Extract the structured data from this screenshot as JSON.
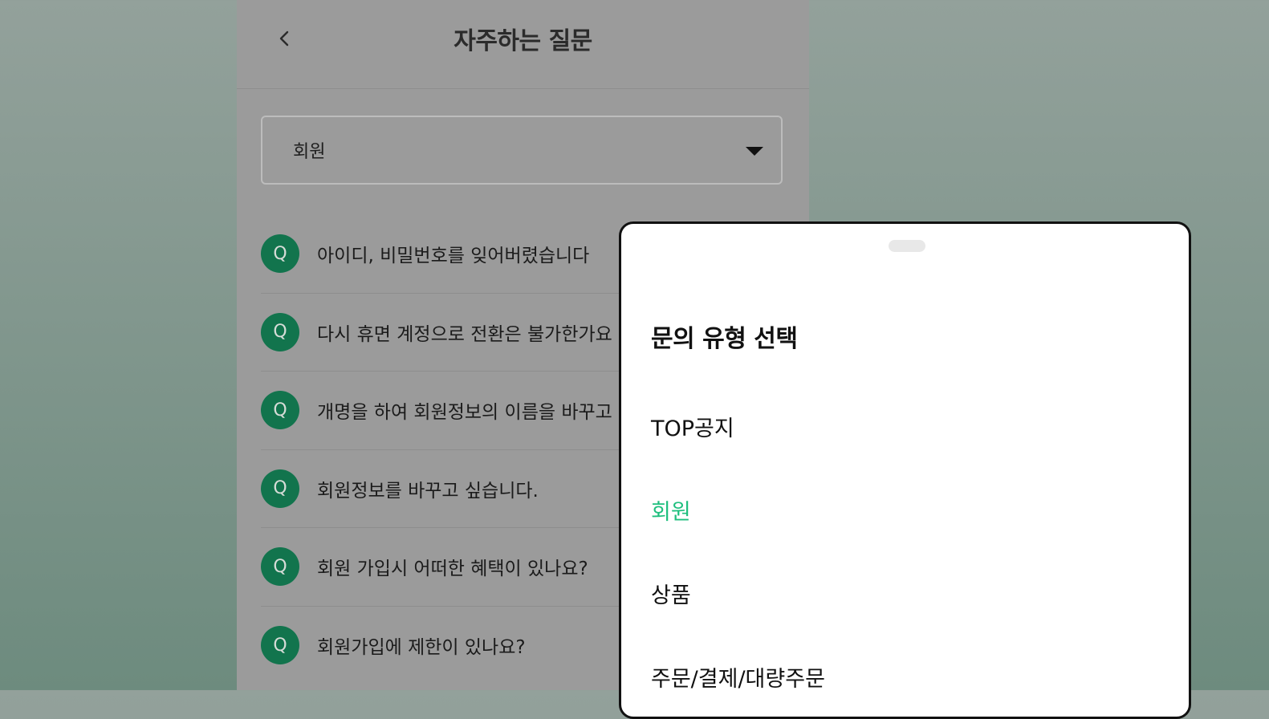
{
  "header": {
    "title": "자주하는 질문"
  },
  "category_select": {
    "value": "회원"
  },
  "faq": {
    "badge": "Q",
    "items": [
      "아이디, 비밀번호를 잊어버렸습니다",
      "다시 휴면 계정으로 전환은 불가한가요",
      "개명을 하여 회원정보의 이름을 바꾸고",
      "회원정보를 바꾸고 싶습니다.",
      "회원 가입시 어떠한 혜택이 있나요?",
      "회원가입에 제한이 있나요?"
    ]
  },
  "sheet": {
    "title": "문의 유형 선택",
    "options": [
      "TOP공지",
      "회원",
      "상품",
      "주문/결제/대량주문"
    ],
    "selected": "회원"
  },
  "colors": {
    "badge": "#12744d",
    "selected_option": "#1fbf7e",
    "overlay_app_bg": "#9b9b9b"
  },
  "icons": {
    "back": "chevron-left-icon",
    "dropdown": "caret-down-icon"
  }
}
